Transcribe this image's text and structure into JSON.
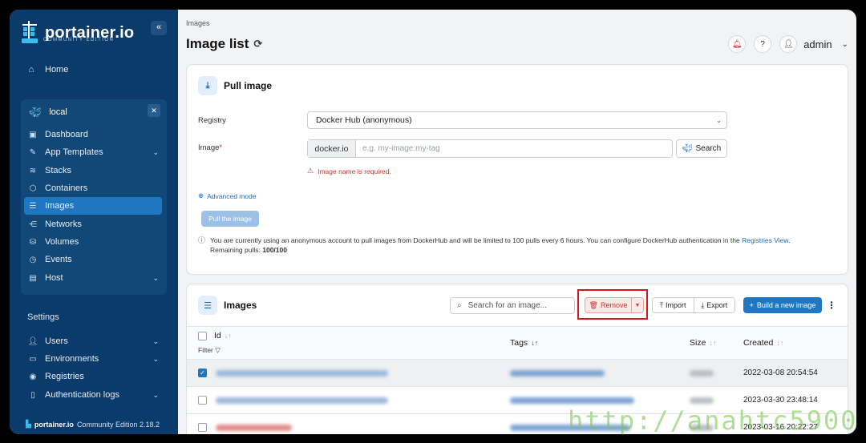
{
  "app": {
    "logo_name": "portainer.io",
    "logo_edition": "COMMUNITY EDITION",
    "footer_name": "portainer.io",
    "footer_version": "Community Edition 2.18.2"
  },
  "sidebar": {
    "home": "Home",
    "environment": "local",
    "env_items": [
      {
        "label": "Dashboard",
        "icon": "dashboard-icon"
      },
      {
        "label": "App Templates",
        "icon": "edit-icon"
      },
      {
        "label": "Stacks",
        "icon": "stacks-icon"
      },
      {
        "label": "Containers",
        "icon": "cube-icon"
      },
      {
        "label": "Images",
        "icon": "list-icon"
      },
      {
        "label": "Networks",
        "icon": "share-icon"
      },
      {
        "label": "Volumes",
        "icon": "database-icon"
      },
      {
        "label": "Events",
        "icon": "clock-icon"
      },
      {
        "label": "Host",
        "icon": "host-icon"
      }
    ],
    "settings_title": "Settings",
    "settings_items": [
      {
        "label": "Users"
      },
      {
        "label": "Environments"
      },
      {
        "label": "Registries"
      },
      {
        "label": "Authentication logs"
      }
    ]
  },
  "header": {
    "breadcrumb": "Images",
    "title": "Image list",
    "user": "admin"
  },
  "pull": {
    "title": "Pull image",
    "registry_label": "Registry",
    "registry_value": "Docker Hub (anonymous)",
    "image_label": "Image",
    "image_required": "*",
    "image_prefix": "docker.io",
    "image_placeholder": "e.g. my-image:my-tag",
    "search_label": "Search",
    "error": "Image name is required.",
    "advanced": "Advanced mode",
    "pull_button": "Pull the image",
    "info_text": "You are currently using an anonymous account to pull images from DockerHub and will be limited to 100 pulls every 6 hours. You can configure DockerHub authentication in the",
    "info_link": "Registries View",
    "info_remaining_label": "Remaining pulls:",
    "info_remaining_value": "100/100"
  },
  "images": {
    "title": "Images",
    "search_placeholder": "Search for an image...",
    "remove": "Remove",
    "import": "Import",
    "export": "Export",
    "build": "Build a new image",
    "columns": {
      "id": "Id",
      "filter": "Filter",
      "tags": "Tags",
      "size": "Size",
      "created": "Created"
    },
    "rows": [
      {
        "created": "2022-03-08 20:54:54",
        "selected": true
      },
      {
        "created": "2023-03-30 23:48:14",
        "selected": false
      },
      {
        "created": "2023-03-16 20:22:27",
        "selected": false
      }
    ]
  },
  "watermark": "http://anahtc5900",
  "colors": {
    "sidebar": "#0b3b6a",
    "accent": "#1f77c2",
    "danger": "#d9141c"
  }
}
